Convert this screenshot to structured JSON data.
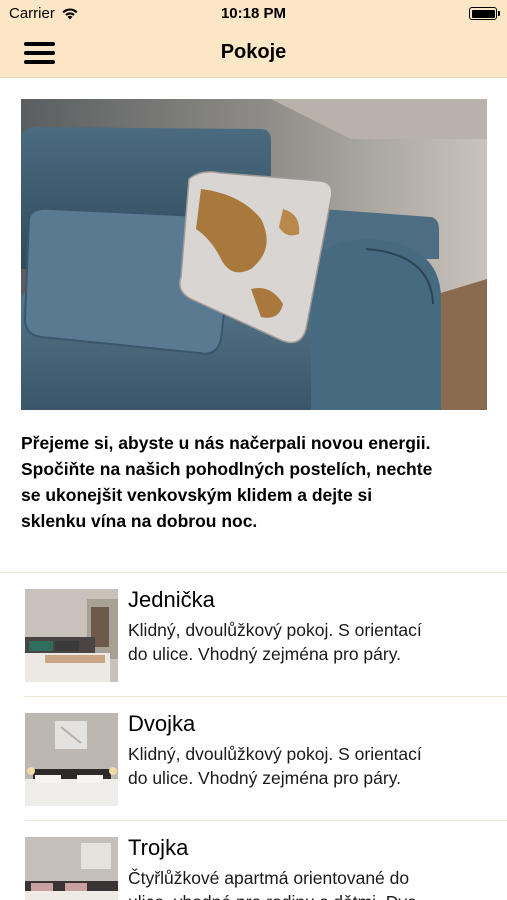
{
  "status_bar": {
    "carrier": "Carrier",
    "time": "10:18 PM"
  },
  "header": {
    "title": "Pokoje",
    "menu_icon": "hamburger-menu-icon"
  },
  "intro": {
    "line1": "Přejeme si, abyste u nás načerpali novou energii.",
    "line2": "Spočiňte na našich pohodlných postelích, nechte",
    "line3": "se ukonejšit venkovským klidem a dejte si",
    "line4": "sklenku vína na dobrou noc."
  },
  "rooms": [
    {
      "name": "Jednička",
      "desc_line1": "Klidný, dvoulůžkový pokoj. S orientací",
      "desc_line2": "do ulice. Vhodný zejména pro páry."
    },
    {
      "name": "Dvojka",
      "desc_line1": "Klidný, dvoulůžkový pokoj. S orientací",
      "desc_line2": "do ulice. Vhodný zejména pro páry."
    },
    {
      "name": "Trojka",
      "desc_line1": "Čtyřlůžkové apartmá orientované do",
      "desc_line2": "ulice, vhodné pro rodinu s dětmi. Dva"
    }
  ]
}
